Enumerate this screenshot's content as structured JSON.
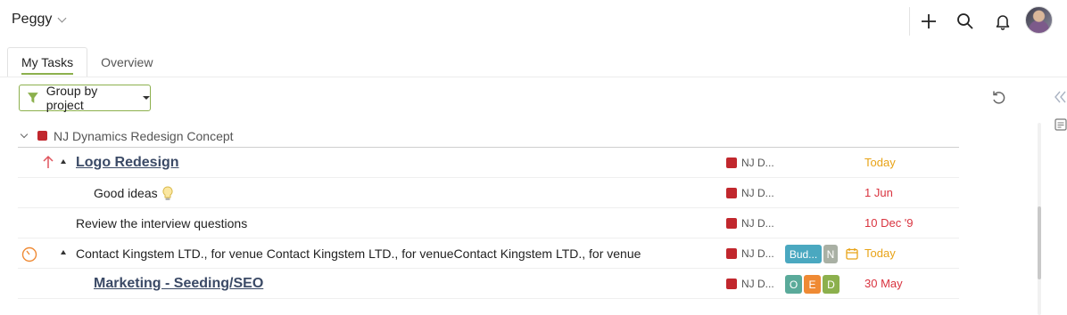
{
  "header": {
    "user_name": "Peggy",
    "icons": [
      "plus-icon",
      "search-icon",
      "bell-icon",
      "avatar"
    ]
  },
  "tabs": [
    {
      "label": "My Tasks",
      "active": true
    },
    {
      "label": "Overview",
      "active": false
    }
  ],
  "toolbar": {
    "group_label": "Group by project",
    "filter_icon_color": "#8cb04d"
  },
  "group": {
    "title": "NJ Dynamics Redesign Concept",
    "color": "#c1272d"
  },
  "tasks": [
    {
      "title": "Logo Redesign",
      "project": "NJ D...",
      "due": "Today",
      "due_color": "#e8a317",
      "priority_icon": "arrow-up-icon",
      "expandable": true,
      "style": "link"
    },
    {
      "title": "Good ideas",
      "project": "NJ D...",
      "due": "1 Jun",
      "due_color": "#d9333f",
      "icon": "lightbulb-icon",
      "expandable": false,
      "style": "plain"
    },
    {
      "title": "Review the interview questions",
      "project": "NJ D...",
      "due": "10 Dec '9",
      "due_color": "#d9333f",
      "expandable": false,
      "style": "plain"
    },
    {
      "title": "Contact Kingstem LTD., for venue Contact Kingstem LTD., for venueContact Kingstem LTD., for venue",
      "project": "NJ D...",
      "due": "Today",
      "due_color": "#e8a317",
      "timer_icon": "timer-icon",
      "expandable": true,
      "style": "plain",
      "tags": [
        {
          "label": "Bud...",
          "color": "#4aa8c0"
        },
        {
          "label": "N",
          "color": "#a9b0a4"
        }
      ],
      "calendar_icon": "calendar-icon"
    },
    {
      "title": "Marketing - Seeding/SEO",
      "project": "NJ D...",
      "due": "30 May",
      "due_color": "#d9333f",
      "expandable": false,
      "style": "link",
      "tags": [
        {
          "label": "O",
          "color": "#5aaa9a"
        },
        {
          "label": "E",
          "color": "#ef8a34"
        },
        {
          "label": "D",
          "color": "#8cb04d"
        }
      ]
    }
  ]
}
